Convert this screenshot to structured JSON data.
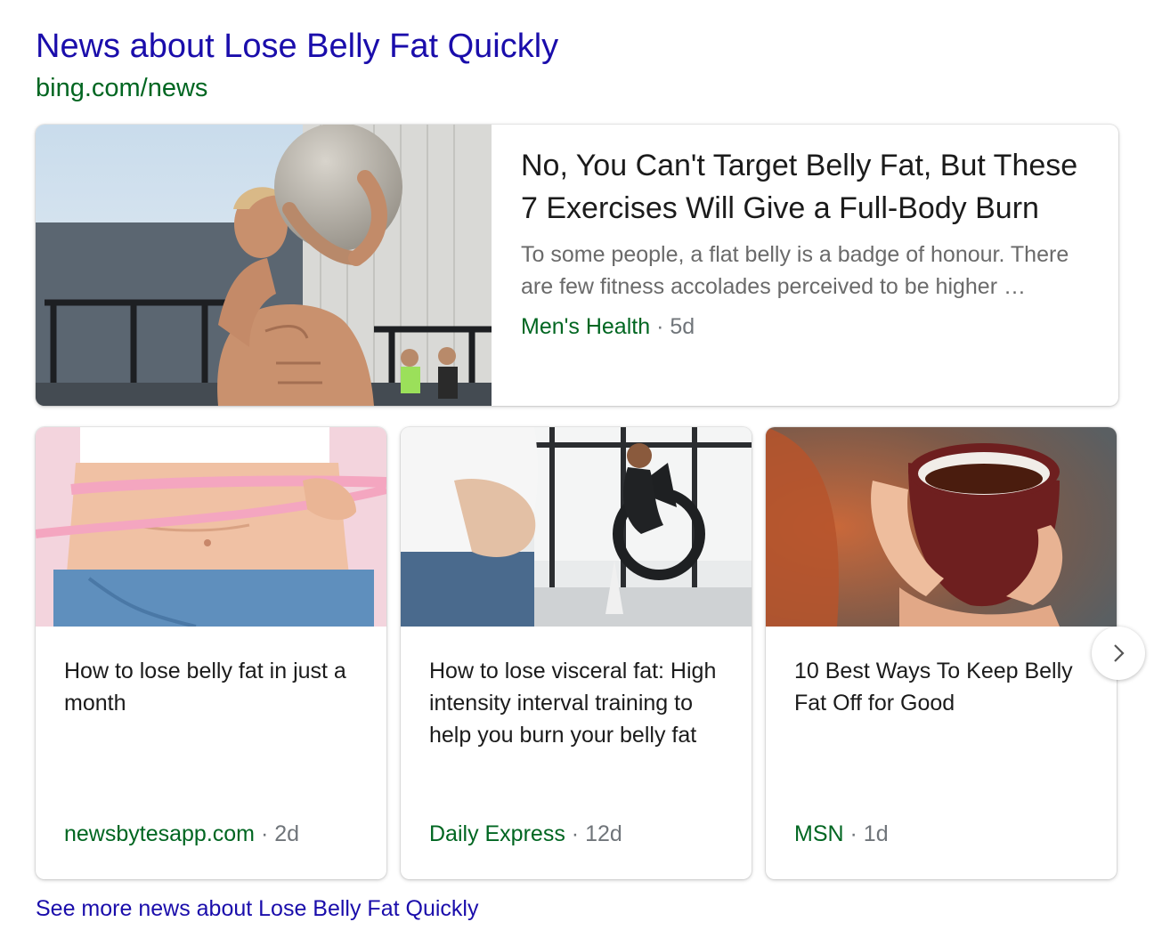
{
  "header": {
    "title": "News about Lose Belly Fat Quickly",
    "url": "bing.com/news"
  },
  "featured": {
    "title": "No, You Can't Target Belly Fat, But These 7 Exercises Will Give a Full-Body Burn",
    "snippet": "To some people, a flat belly is a badge of honour. There are few fitness accolades perceived to be higher …",
    "source": "Men's Health",
    "separator": "·",
    "age": "5d",
    "image": "man-carrying-stone-ball-gym-photo"
  },
  "cards": [
    {
      "title": "How to lose belly fat in just a month",
      "source": "newsbytesapp.com",
      "separator": "·",
      "age": "2d",
      "image": "waist-measuring-tape-photo"
    },
    {
      "title": "How to lose visceral fat: High intensity interval training to help you burn your belly fat",
      "source": "Daily Express",
      "separator": "·",
      "age": "12d",
      "image": "air-bike-workout-photo"
    },
    {
      "title": "10 Best Ways To Keep Belly Fat Off for Good",
      "source": "MSN",
      "separator": "·",
      "age": "1d",
      "image": "hands-holding-tea-mug-photo"
    }
  ],
  "next_button": {
    "icon": "chevron-right-icon"
  },
  "see_more": "See more news about Lose Belly Fat Quickly",
  "colors": {
    "link": "#1a0dab",
    "url_green": "#006621",
    "text": "#1b1b1b",
    "muted": "#6a6a6a"
  }
}
